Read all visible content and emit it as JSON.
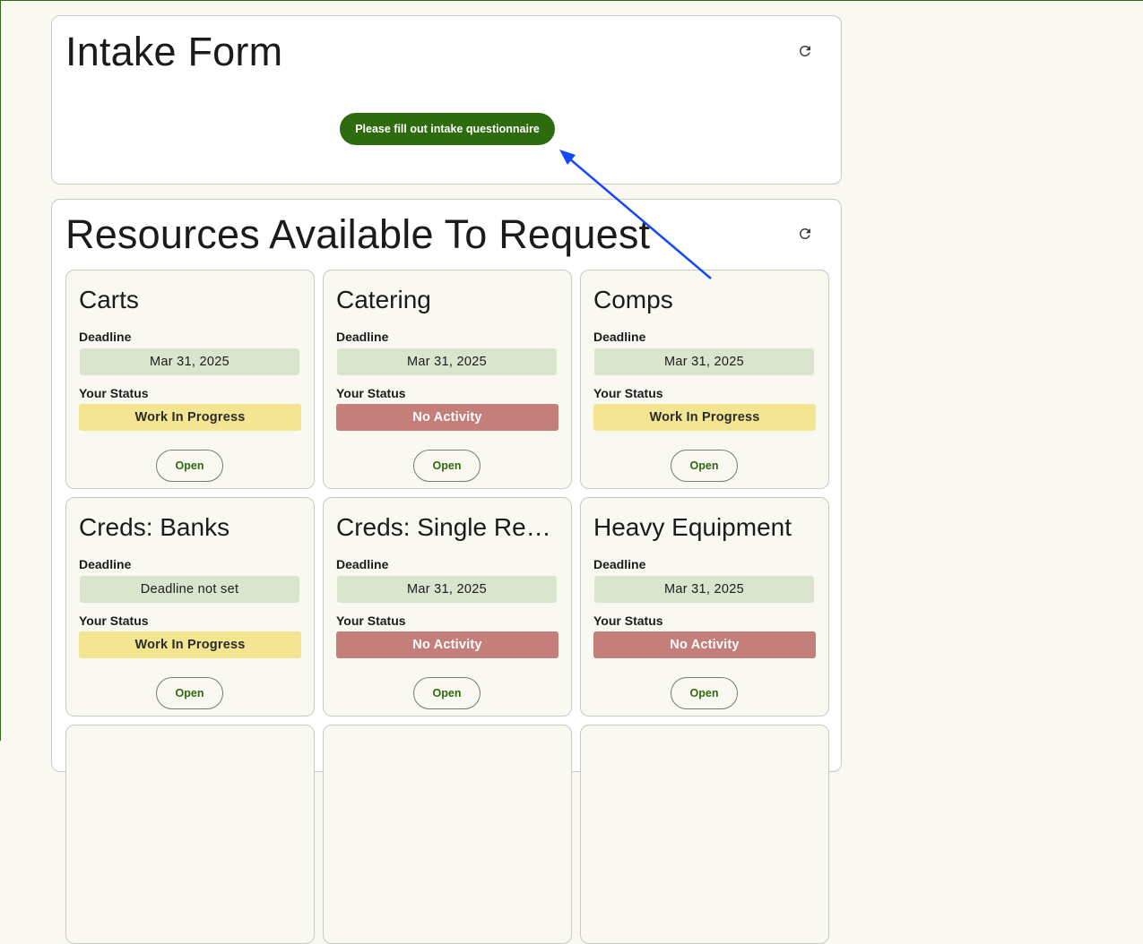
{
  "intake": {
    "title": "Intake Form",
    "button_label": "Please fill out intake questionnaire"
  },
  "resources": {
    "title": "Resources Available To Request",
    "deadline_label": "Deadline",
    "status_label": "Your Status",
    "open_label": "Open",
    "cards": [
      {
        "title": "Carts",
        "deadline": "Mar 31, 2025",
        "status": "Work In Progress"
      },
      {
        "title": "Catering",
        "deadline": "Mar 31, 2025",
        "status": "No Activity"
      },
      {
        "title": "Comps",
        "deadline": "Mar 31, 2025",
        "status": "Work In Progress"
      },
      {
        "title": "Creds: Banks",
        "deadline": "Deadline not set",
        "status": "Work In Progress"
      },
      {
        "title": "Creds: Single Req…",
        "deadline": "Mar 31, 2025",
        "status": "No Activity"
      },
      {
        "title": "Heavy Equipment",
        "deadline": "Mar 31, 2025",
        "status": "No Activity"
      },
      {
        "title": "",
        "deadline": "",
        "status": ""
      },
      {
        "title": "",
        "deadline": "",
        "status": ""
      },
      {
        "title": "",
        "deadline": "",
        "status": ""
      }
    ]
  },
  "icons": {
    "refresh": "refresh-icon",
    "annotation": "arrow-annotation"
  },
  "colors": {
    "brand_green": "#2e6a0e",
    "deadline_bg": "#dae5cd",
    "status_wip": "#f4e592",
    "status_none": "#c57f7b",
    "annotation_arrow": "#1448ff"
  }
}
